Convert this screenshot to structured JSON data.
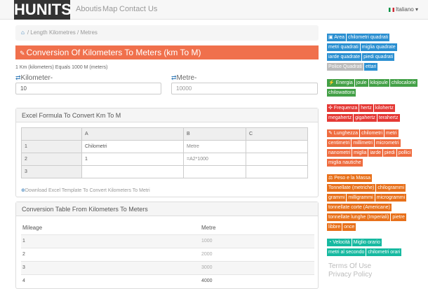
{
  "nav": {
    "brand": "HUNITS",
    "links": [
      "Aboutis",
      "Map",
      "Contact Us"
    ],
    "language": "Italiano"
  },
  "breadcrumb": "/ Length Kilometres / Metres",
  "title": "Conversion Of Kilometers To Meters (km To M)",
  "equals": "1 Km (kilometers) Equals 1000 M (meters)",
  "input_left": {
    "label": "Kilometer-",
    "value": "10"
  },
  "input_right": {
    "label": "Metre-",
    "value": "10000"
  },
  "excel": {
    "heading": "Excel Formula To Convert Km To M",
    "cols": [
      "A",
      "B",
      "C"
    ],
    "rows": [
      {
        "n": "1",
        "a": "Chilometri",
        "b": "Metre",
        "c": ""
      },
      {
        "n": "2",
        "a": "1",
        "b": "=A2*1000",
        "c": ""
      },
      {
        "n": "3",
        "a": "",
        "b": "",
        "c": ""
      }
    ],
    "download": "Download Excel Template To Convert Kilometers To Metri"
  },
  "conversion": {
    "heading": "Conversion Table From Kilometers To Meters",
    "cols": [
      "Mileage",
      "Metre"
    ],
    "rows": [
      [
        "1",
        "1000"
      ],
      [
        "2",
        "2000"
      ],
      [
        "3",
        "3000"
      ],
      [
        "4",
        "4000"
      ]
    ]
  },
  "sidebar": {
    "area": [
      "Area",
      "chilometri quadrati",
      "metri quadrati",
      "miglia quadrate",
      "iarde quadrate",
      "piedi quadrati",
      "Police Quadrati",
      "ettari"
    ],
    "energia": [
      "Energia",
      "joule",
      "kilojoule",
      "chilocalorie",
      "chilowattora"
    ],
    "frequenza": [
      "Frequenza",
      "hertz",
      "kilohertz",
      "megahertz",
      "gigahertz",
      "terahertz"
    ],
    "lunghezza": [
      "Lunghezza",
      "chilometri",
      "metri",
      "centimetri",
      "millimetri",
      "micrometri",
      "nanometri",
      "miglia",
      "iarde",
      "piedi",
      "pollici",
      "miglia nautiche"
    ],
    "peso": [
      "Peso e la Massa",
      "Tonnellate (metriche)",
      "chilogrammi",
      "grammi",
      "milligrammi",
      "microgrammi",
      "tonnellate corte (Americane)",
      "tonnellate lunghe (Imperiali)",
      "pietre",
      "libbre",
      "once"
    ],
    "velocita": [
      "Velocità",
      "Miglio orario",
      "metri al secondo",
      "chilometri orari"
    ],
    "terms": "Terms Of Use",
    "privacy": "Privacy Policy"
  },
  "colors": {
    "title_bar": "#f0704c",
    "brand_bg": "#333333",
    "area": "#2a8fd1",
    "energia": "#43a047",
    "frequenza": "#e53935",
    "lunghezza": "#ef6c3f",
    "peso": "#e8701a",
    "velocita": "#16b9a0"
  }
}
